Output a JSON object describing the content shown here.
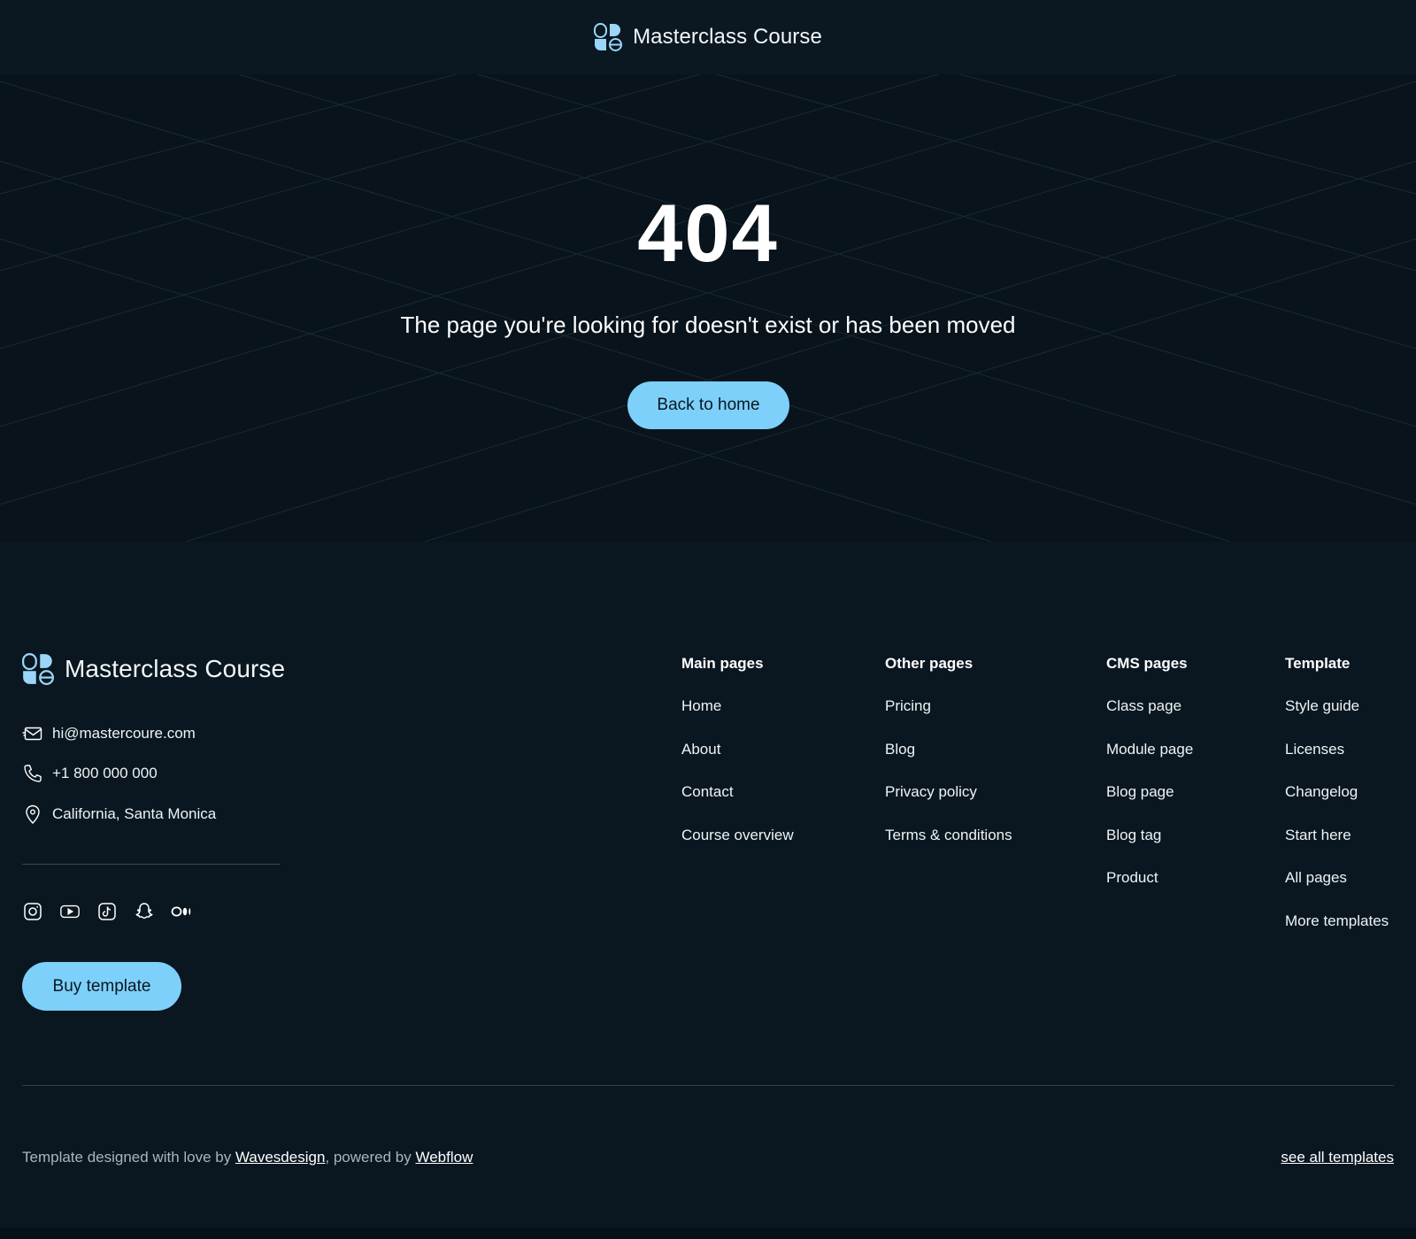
{
  "header": {
    "brand": "Masterclass Course"
  },
  "hero": {
    "code": "404",
    "message": "The page you're looking for doesn't exist or has been moved",
    "button_label": "Back to home"
  },
  "footer": {
    "brand": "Masterclass Course",
    "contact": {
      "email": "hi@mastercoure.com",
      "phone": "+1 800 000 000",
      "location": "California, Santa Monica"
    },
    "social_icons": [
      "instagram-icon",
      "youtube-icon",
      "tiktok-icon",
      "snapchat-icon",
      "medium-icon"
    ],
    "buy_button_label": "Buy template",
    "columns": [
      {
        "title": "Main pages",
        "links": [
          "Home",
          "About",
          "Contact",
          "Course overview"
        ]
      },
      {
        "title": "Other pages",
        "links": [
          "Pricing",
          "Blog",
          "Privacy policy",
          "Terms & conditions"
        ]
      },
      {
        "title": "CMS pages",
        "links": [
          "Class page",
          "Module page",
          "Blog page",
          "Blog tag",
          "Product"
        ]
      },
      {
        "title": "Template",
        "links": [
          "Style guide",
          "Licenses",
          "Changelog",
          "Start here",
          "All pages",
          "More templates"
        ]
      }
    ],
    "credits": {
      "prefix": "Template designed with love by ",
      "designer": "Wavesdesign",
      "middle": ", powered by ",
      "platform": "Webflow"
    },
    "see_all_label": "see all templates"
  },
  "colors": {
    "accent": "#7dd0fa",
    "background": "#0a1720",
    "hero_background": "#08131b"
  }
}
